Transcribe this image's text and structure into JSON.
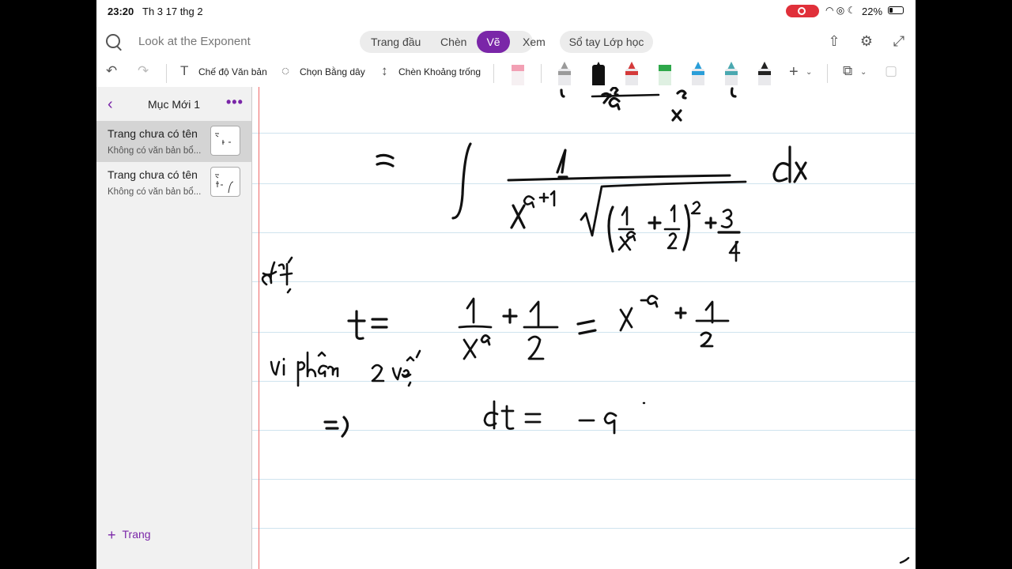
{
  "status_bar": {
    "time": "23:20",
    "date": "Th 3 17 thg 2",
    "battery": "22%"
  },
  "top_bar": {
    "search_placeholder": "Look at the Exponent",
    "tabs": [
      "Trang đầu",
      "Chèn",
      "Vẽ",
      "Xem"
    ],
    "active_tab": "Vẽ",
    "notebook_button": "Sổ tay Lớp học"
  },
  "toolbar": {
    "text_mode": "Chế độ Văn bản",
    "lasso_select": "Chọn Bằng dây",
    "insert_space": "Chèn Khoảng trống",
    "pens": [
      {
        "name": "highlighter",
        "color": "#f2a0b4"
      },
      {
        "name": "pen-grey",
        "color": "#9a9a9a"
      },
      {
        "name": "pen-black",
        "color": "#111111"
      },
      {
        "name": "pen-red",
        "color": "#d43a3a"
      },
      {
        "name": "pen-green",
        "color": "#2ea84a"
      },
      {
        "name": "pen-blue",
        "color": "#2a9ed8"
      },
      {
        "name": "pen-teal",
        "color": "#4aa8b0"
      },
      {
        "name": "pen-dark",
        "color": "#222222"
      }
    ]
  },
  "sidebar": {
    "section_title": "Mục Mới 1",
    "pages": [
      {
        "title": "Trang chưa có tên",
        "subtitle": "Không có văn bản bổ...",
        "selected": true
      },
      {
        "title": "Trang chưa có tên",
        "subtitle": "Không có văn bản bổ...",
        "selected": false
      }
    ],
    "add_page_label": "Trang"
  },
  "colors": {
    "accent": "#7a26a8",
    "ruled_line": "#cfe3ee",
    "margin_line": "#f06a6a",
    "ink": "#111111"
  }
}
